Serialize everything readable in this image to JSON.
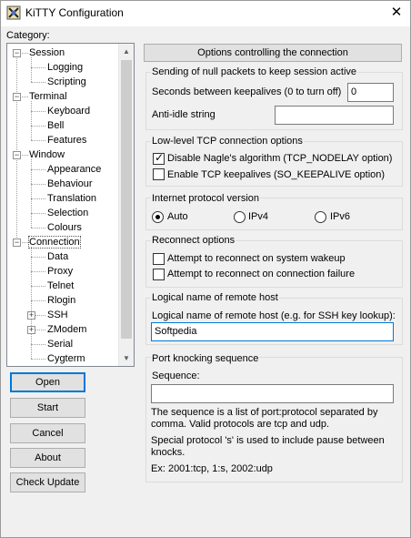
{
  "window": {
    "title": "KiTTY Configuration",
    "close_glyph": "✕"
  },
  "category_label": "Category:",
  "tree": [
    {
      "label": "Session",
      "level": 0,
      "expander": "−"
    },
    {
      "label": "Logging",
      "level": 1
    },
    {
      "label": "Scripting",
      "level": 1
    },
    {
      "label": "Terminal",
      "level": 0,
      "expander": "−"
    },
    {
      "label": "Keyboard",
      "level": 1
    },
    {
      "label": "Bell",
      "level": 1
    },
    {
      "label": "Features",
      "level": 1
    },
    {
      "label": "Window",
      "level": 0,
      "expander": "−"
    },
    {
      "label": "Appearance",
      "level": 1
    },
    {
      "label": "Behaviour",
      "level": 1
    },
    {
      "label": "Translation",
      "level": 1
    },
    {
      "label": "Selection",
      "level": 1
    },
    {
      "label": "Colours",
      "level": 1
    },
    {
      "label": "Connection",
      "level": 0,
      "expander": "−",
      "selected": true
    },
    {
      "label": "Data",
      "level": 1
    },
    {
      "label": "Proxy",
      "level": 1
    },
    {
      "label": "Telnet",
      "level": 1
    },
    {
      "label": "Rlogin",
      "level": 1
    },
    {
      "label": "SSH",
      "level": 1,
      "expander": "+"
    },
    {
      "label": "ZModem",
      "level": 1,
      "expander": "+"
    },
    {
      "label": "Serial",
      "level": 1
    },
    {
      "label": "Cygterm",
      "level": 1
    }
  ],
  "buttons": {
    "open": "Open",
    "start": "Start",
    "cancel": "Cancel",
    "about": "About",
    "check_update": "Check Update"
  },
  "panel": {
    "header": "Options controlling the connection",
    "keepalive": {
      "title": "Sending of null packets to keep session active",
      "seconds_label": "Seconds between keepalives (0 to turn off)",
      "seconds_value": "0",
      "antiidle_label": "Anti-idle string",
      "antiidle_value": ""
    },
    "tcp": {
      "title": "Low-level TCP connection options",
      "nagle_label": "Disable Nagle's algorithm (TCP_NODELAY option)",
      "nagle_checked": true,
      "keepalive_label": "Enable TCP keepalives (SO_KEEPALIVE option)",
      "keepalive_checked": false
    },
    "ip": {
      "title": "Internet protocol version",
      "auto": "Auto",
      "ipv4": "IPv4",
      "ipv6": "IPv6",
      "selected": "Auto"
    },
    "reconnect": {
      "title": "Reconnect options",
      "wakeup_label": "Attempt to reconnect on system wakeup",
      "failure_label": "Attempt to reconnect on connection failure"
    },
    "logical": {
      "title": "Logical name of remote host",
      "field_label": "Logical name of remote host (e.g. for SSH key lookup):",
      "field_value": "Softpedia"
    },
    "knock": {
      "title": "Port knocking sequence",
      "sequence_label": "Sequence:",
      "sequence_value": "",
      "note1_line1": "The sequence is a list of port:protocol separated by",
      "note1_line2": "comma. Valid protocols are tcp and udp.",
      "note2_line1": "Special protocol 's' is used to include pause between",
      "note2_line2": "knocks.",
      "example": "Ex: 2001:tcp, 1:s, 2002:udp"
    }
  }
}
